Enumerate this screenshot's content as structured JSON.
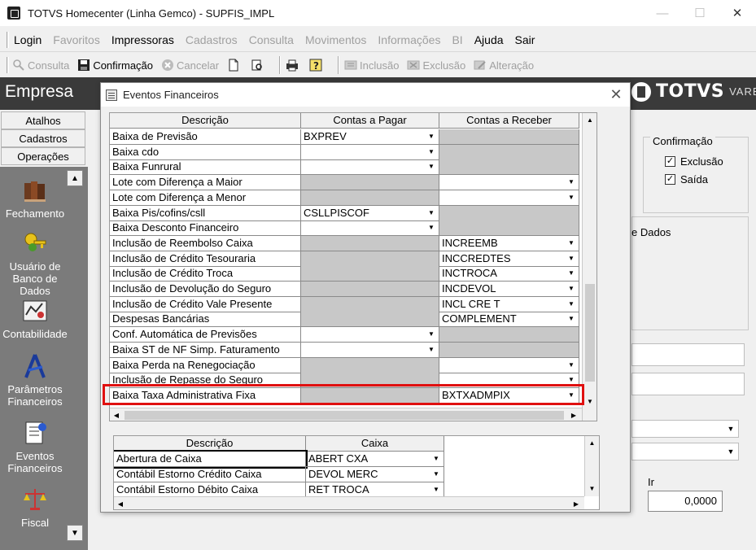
{
  "window": {
    "title": "TOTVS Homecenter (Linha Gemco) - SUPFIS_IMPL",
    "minimize": "—",
    "maximize": "☐",
    "close": "✕"
  },
  "menu": [
    {
      "label": "Login",
      "enabled": true
    },
    {
      "label": "Favoritos",
      "enabled": false
    },
    {
      "label": "Impressoras",
      "enabled": true
    },
    {
      "label": "Cadastros",
      "enabled": false
    },
    {
      "label": "Consulta",
      "enabled": false
    },
    {
      "label": "Movimentos",
      "enabled": false
    },
    {
      "label": "Informações",
      "enabled": false
    },
    {
      "label": "BI",
      "enabled": false
    },
    {
      "label": "Ajuda",
      "enabled": true
    },
    {
      "label": "Sair",
      "enabled": true
    }
  ],
  "toolbar": {
    "consulta": "Consulta",
    "confirmacao": "Confirmação",
    "cancelar": "Cancelar",
    "inclusao": "Inclusão",
    "exclusao": "Exclusão",
    "alteracao": "Alteração"
  },
  "header": {
    "empresa": "Empresa",
    "brand": "TOTVS",
    "brand_sub": "VAREJO"
  },
  "sidebar": {
    "tabs": [
      "Atalhos",
      "Cadastros",
      "Operações"
    ],
    "items": [
      {
        "label": "Fechamento",
        "icon": "books-icon"
      },
      {
        "label": "Usuário de Banco de Dados",
        "icon": "keys-icon"
      },
      {
        "label": "Contabilidade",
        "icon": "map-icon"
      },
      {
        "label": "Parâmetros Financeiros",
        "icon": "compass-icon"
      },
      {
        "label": "Eventos Financeiros",
        "icon": "document-icon"
      },
      {
        "label": "Fiscal",
        "icon": "scales-icon"
      }
    ]
  },
  "background": {
    "confirmacao_label": "Confirmação",
    "exclusao_label": "Exclusão",
    "saida_label": "Saída",
    "dados_label": "e Dados",
    "ir_label": "Ir",
    "ir_value": "0,0000"
  },
  "dialog": {
    "title": "Eventos Financeiros",
    "grid1": {
      "columns": [
        "Descrição",
        "Contas a Pagar",
        "Contas a Receber"
      ],
      "rows": [
        {
          "d": "Baixa de Previsão",
          "p": "BXPREV",
          "pg": false,
          "pdd": true,
          "r": "",
          "rg": true,
          "rdd": false
        },
        {
          "d": "Baixa cdo",
          "p": "",
          "pg": false,
          "pdd": true,
          "r": "",
          "rg": true,
          "rdd": false
        },
        {
          "d": "Baixa Funrural",
          "p": "",
          "pg": false,
          "pdd": true,
          "r": "",
          "rg": true,
          "rdd": false
        },
        {
          "d": "Lote com Diferença a Maior",
          "p": "",
          "pg": true,
          "pdd": false,
          "r": "",
          "rg": false,
          "rdd": true
        },
        {
          "d": "Lote com Diferença a Menor",
          "p": "",
          "pg": true,
          "pdd": false,
          "r": "",
          "rg": false,
          "rdd": true
        },
        {
          "d": "Baixa Pis/cofins/csll",
          "p": "CSLLPISCOF",
          "pg": false,
          "pdd": true,
          "r": "",
          "rg": true,
          "rdd": false
        },
        {
          "d": "Baixa Desconto Financeiro",
          "p": "",
          "pg": false,
          "pdd": true,
          "r": "",
          "rg": true,
          "rdd": false
        },
        {
          "d": "Inclusão de Reembolso Caixa",
          "p": "",
          "pg": true,
          "pdd": false,
          "r": "INCREEMB",
          "rg": false,
          "rdd": true
        },
        {
          "d": "Inclusão de Crédito Tesouraria",
          "p": "",
          "pg": true,
          "pdd": false,
          "r": "INCCREDTES",
          "rg": false,
          "rdd": true
        },
        {
          "d": "Inclusão de Crédito Troca",
          "p": "",
          "pg": true,
          "pdd": false,
          "r": "INCTROCA",
          "rg": false,
          "rdd": true
        },
        {
          "d": "Inclusão de Devolução do Seguro",
          "p": "",
          "pg": true,
          "pdd": false,
          "r": "INCDEVOL",
          "rg": false,
          "rdd": true
        },
        {
          "d": "Inclusão de Crédito Vale Presente",
          "p": "",
          "pg": true,
          "pdd": false,
          "r": "INCL CRE T",
          "rg": false,
          "rdd": true
        },
        {
          "d": "Despesas Bancárias",
          "p": "",
          "pg": true,
          "pdd": false,
          "r": "COMPLEMENT",
          "rg": false,
          "rdd": true
        },
        {
          "d": "Conf. Automática de Previsões",
          "p": "",
          "pg": false,
          "pdd": true,
          "r": "",
          "rg": true,
          "rdd": false
        },
        {
          "d": "Baixa ST de NF Simp. Faturamento",
          "p": "",
          "pg": false,
          "pdd": true,
          "r": "",
          "rg": true,
          "rdd": false
        },
        {
          "d": "Baixa Perda na Renegociação",
          "p": "",
          "pg": true,
          "pdd": false,
          "r": "",
          "rg": false,
          "rdd": true
        },
        {
          "d": "Inclusão de Repasse do Seguro",
          "p": "",
          "pg": true,
          "pdd": false,
          "r": "",
          "rg": false,
          "rdd": true
        },
        {
          "d": "Baixa Taxa Administrativa Fixa",
          "p": "",
          "pg": true,
          "pdd": false,
          "r": "BXTXADMPIX",
          "rg": false,
          "rdd": true
        }
      ]
    },
    "grid2": {
      "columns": [
        "Descrição",
        "Caixa"
      ],
      "rows": [
        {
          "d": "Abertura de Caixa",
          "c": "ABERT CXA"
        },
        {
          "d": "Contábil Estorno Crédito Caixa",
          "c": "DEVOL MERC"
        },
        {
          "d": "Contábil Estorno Débito Caixa",
          "c": "RET TROCA"
        }
      ]
    }
  },
  "colors": {
    "highlight": "#e01010",
    "header_dark": "#3a3a3a",
    "sidebar_panel": "#7b7b7b",
    "disabled_cell": "#c8c8c8"
  }
}
